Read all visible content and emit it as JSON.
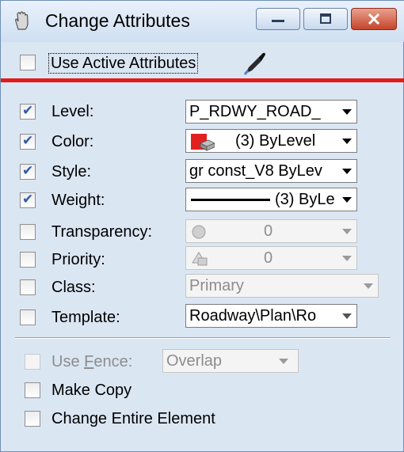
{
  "window": {
    "title": "Change Attributes"
  },
  "use_active_attributes": {
    "label": "Use Active Attributes",
    "checked": false
  },
  "attributes": [
    {
      "key": "level",
      "label": "Level:",
      "checked": true,
      "value": "P_RDWY_ROAD_"
    },
    {
      "key": "color",
      "label": "Color:",
      "checked": true,
      "value": "(3) ByLevel",
      "swatch_color": "#e32020"
    },
    {
      "key": "style",
      "label": "Style:",
      "checked": true,
      "value": "gr const_V8  ByLev"
    },
    {
      "key": "weight",
      "label": "Weight:",
      "checked": true,
      "value": "(3) ByLe"
    },
    {
      "key": "transparency",
      "label": "Transparency:",
      "checked": false,
      "value": "0"
    },
    {
      "key": "priority",
      "label": "Priority:",
      "checked": false,
      "value": "0"
    },
    {
      "key": "class",
      "label": "Class:",
      "checked": false,
      "value": "Primary"
    },
    {
      "key": "template",
      "label": "Template:",
      "checked": false,
      "value": "Roadway\\Plan\\Ro"
    }
  ],
  "use_fence": {
    "label": "Use Fence:",
    "checked": false,
    "value": "Overlap"
  },
  "make_copy": {
    "label": "Make Copy",
    "checked": false
  },
  "change_entire_element": {
    "label": "Change Entire Element",
    "checked": false
  },
  "icons": {
    "app": "hand-icon",
    "pick": "eyedropper-icon"
  },
  "colors": {
    "accent": "#e31b1b",
    "check": "#2f5aa6",
    "title_bg": "#dbe6f3"
  }
}
